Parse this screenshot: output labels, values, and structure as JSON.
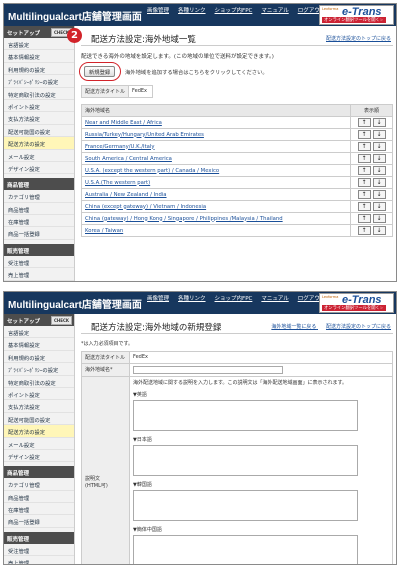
{
  "header": {
    "logo": "Multilingualcart店舗管理画面",
    "nav": [
      "画像管理",
      "各種リンク",
      "ショップ内FPC",
      "マニュアル",
      "ログアウト"
    ],
    "etrans": {
      "small": "Lexforma",
      "big": "e-Trans",
      "tag": "オンライン翻訳ツールを開く☞"
    }
  },
  "sidebar": {
    "setup_label": "セットアップ",
    "check_label": "CHECK",
    "items": [
      "言語設定",
      "基本情報設定",
      "利用規約の設定",
      "ﾌﾟﾗｲﾊﾞｼｰﾎﾟﾘｼｰの設定",
      "特定商取引法の設定",
      "ポイント設定",
      "支払方法設定",
      "配送可能国の設定",
      "配送方法の設定",
      "メール設定",
      "デザイン設定"
    ],
    "active_index": 8,
    "sections": [
      {
        "title": "商品管理",
        "items": [
          "カテゴリ管理",
          "商品管理",
          "在庫管理",
          "商品一括登録"
        ]
      },
      {
        "title": "販売管理",
        "items": [
          "受注管理",
          "売上管理"
        ]
      }
    ]
  },
  "screen1": {
    "badge": "2",
    "title": "配送方法設定:海外地域一覧",
    "top_link": "配送方法設定のトップに戻る",
    "note": "配送できる海外の地域を設定します。(この地域の単位で送料が設定できます。)",
    "new_button": "新規登録",
    "new_note": "海外地域を追加する場合はこちらをクリックしてください。",
    "method_label": "配送方法タイトル",
    "method_value": "FedEx",
    "table_header": {
      "name": "海外地域名",
      "order": "表示順"
    },
    "arrow_up": "↑",
    "arrow_down": "↓",
    "rows": [
      "Near and Middle East / Africa",
      "Russia/Turkey/Hungary/United Arab Emirates",
      "France/Germany/U.K./Italy",
      "South America / Central America",
      "U.S.A. (except the western part) / Canada / Mexico",
      "U.S.A.(The western part)",
      "Australia / New Zealand / India",
      "China (except gateway) / Vietnam / Indonesia",
      "China (gateway) / Hong Kong / Singapore / Philippines /Malaysia / Thailand",
      "Korea / Taiwan"
    ]
  },
  "screen2": {
    "title": "配送方法設定:海外地域の新規登録",
    "link_back": "海外地域一覧に戻る",
    "link_top": "配送方法設定のトップに戻る",
    "required_note": "*は入力必須項目です。",
    "method_label": "配送方法タイトル",
    "method_value": "FedEx",
    "region_label": "海外地域名*",
    "desc_label": "説明文\n(HTML可)",
    "desc_intro": "海外配送地域に関する説明を入力します。この説明文は「海外配送地域画面」に表示されます。",
    "langs": [
      "▼英語",
      "▼日本語",
      "▼韓国語",
      "▼簡体中国語"
    ]
  }
}
